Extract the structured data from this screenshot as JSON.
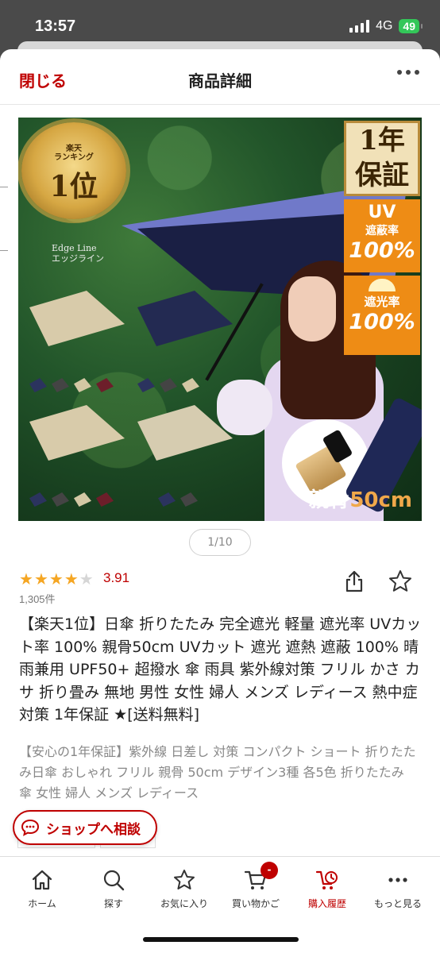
{
  "status_bar": {
    "time": "13:57",
    "network": "4G",
    "battery": "49"
  },
  "nav": {
    "close_label": "閉じる",
    "title": "商品詳細"
  },
  "hero": {
    "medal_sub": "楽天\nランキング",
    "medal_main": "1位",
    "brand_label": "Edge Line\nエッジライン",
    "warranty_line1": "1年",
    "warranty_line2": "保証",
    "uv_title": "UV",
    "uv_sub": "遮蔽率",
    "uv_percent": "100%",
    "shade_sub": "遮光率",
    "shade_percent": "100%",
    "rib_prefix": "親骨",
    "rib_value": "50cm",
    "colors": {
      "accent": "#ee8c15",
      "gold": "#d6a743"
    }
  },
  "pager": {
    "text": "1/10"
  },
  "rating": {
    "value": "3.91",
    "count": "1,305件",
    "stars_filled": 4,
    "stars_total": 5
  },
  "product": {
    "title": "【楽天1位】日傘 折りたたみ 完全遮光 軽量 遮光率 UVカット率 100% 親骨50cm UVカット 遮光 遮熱 遮蔽 100% 晴雨兼用 UPF50+ 超撥水 傘 雨具 紫外線対策 フリル かさ カサ 折り畳み 無地 男性 女性 婦人 メンズ レディース 熱中症対策 1年保証 ★[送料無料]",
    "description": "【安心の1年保証】紫外線 日差し 対策 コンパクト ショート 折りたたみ日傘 おしゃれ フリル 親骨 50cm デザイン3種 各5色 折りたたみ傘 女性 婦人 メンズ レディース"
  },
  "consult": {
    "label": "ショップへ相談"
  },
  "tabs": [
    {
      "label": "ホーム",
      "icon": "home-icon"
    },
    {
      "label": "探す",
      "icon": "search-icon"
    },
    {
      "label": "お気に入り",
      "icon": "star-icon"
    },
    {
      "label": "買い物かご",
      "icon": "cart-icon",
      "badge": "-"
    },
    {
      "label": "購入履歴",
      "icon": "purchase-history-icon",
      "active": true
    },
    {
      "label": "もっと見る",
      "icon": "more-icon"
    }
  ],
  "theme": {
    "brand_red": "#bf0000",
    "star_color": "#f5a623"
  }
}
